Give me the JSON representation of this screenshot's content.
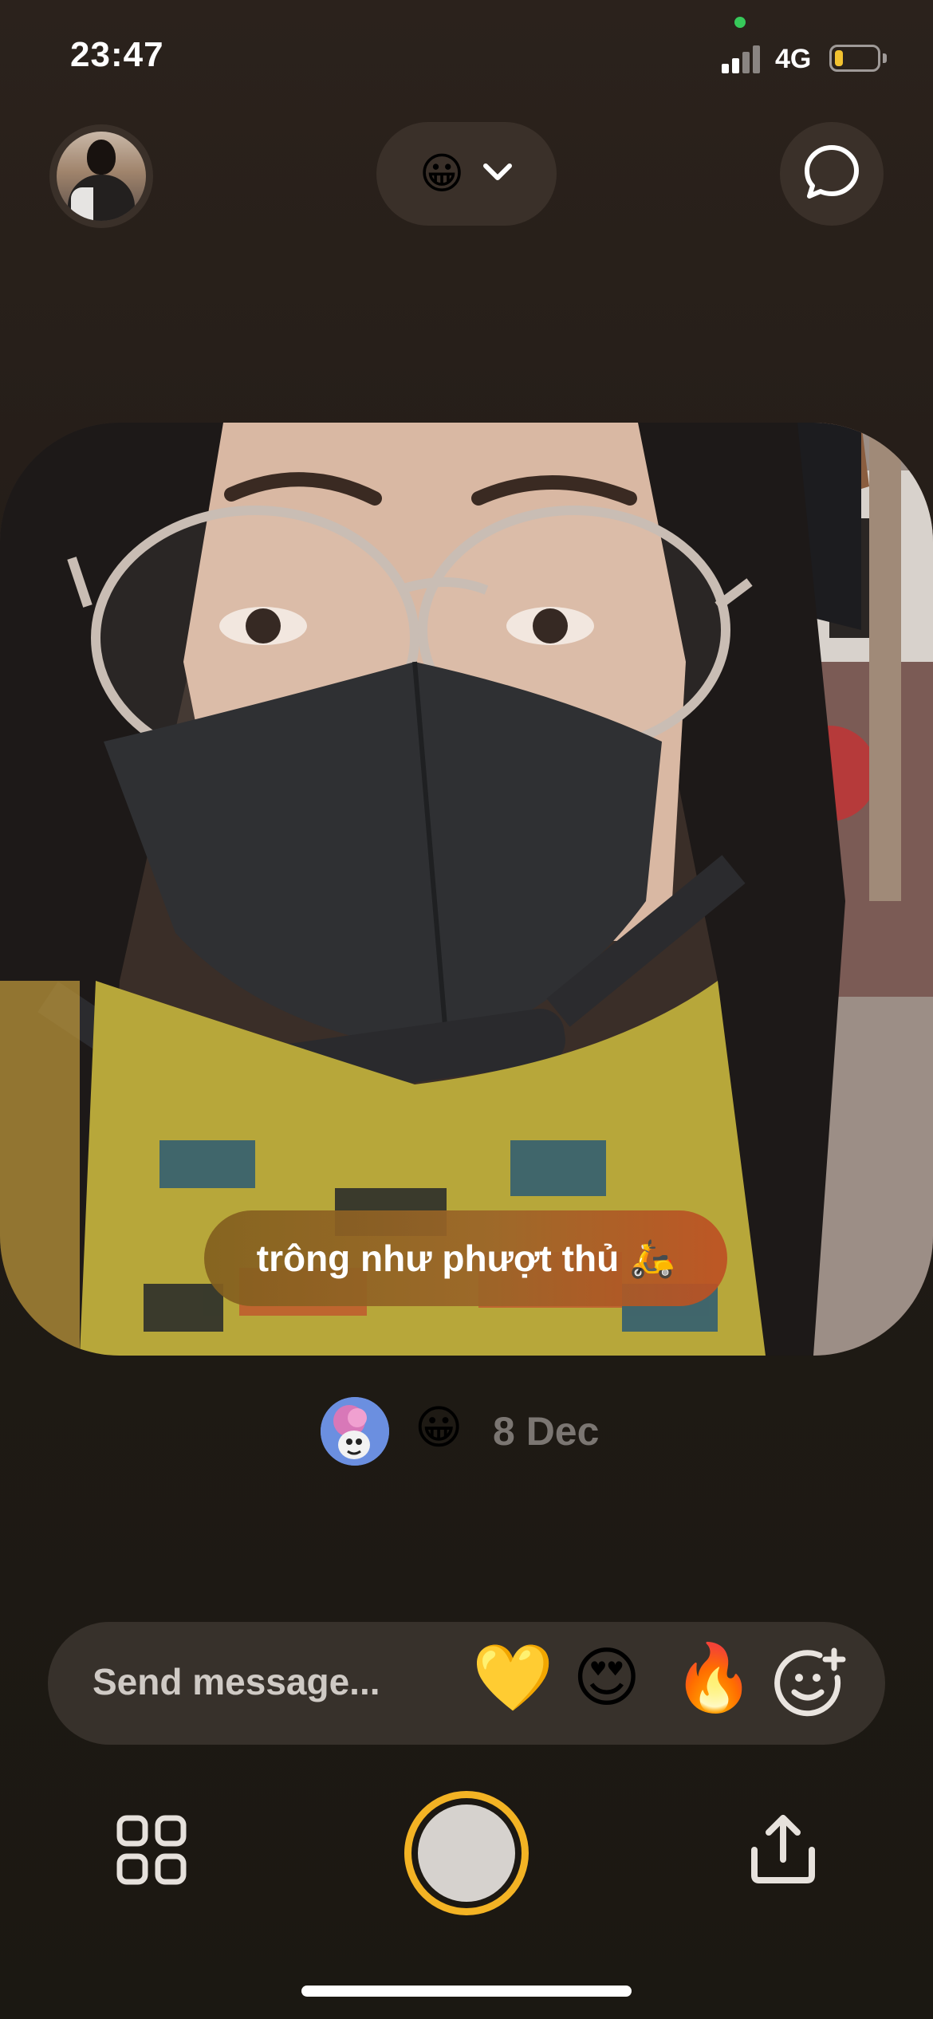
{
  "status_bar": {
    "time": "23:47",
    "network": "4G",
    "battery_level_fraction": 0.2,
    "battery_color": "#f2c230"
  },
  "top_bar": {
    "avatar_icon": "profile-avatar",
    "filter_emoji": "😀",
    "filter_dropdown_icon": "chevron-down-icon",
    "chat_icon": "chat-bubble-icon"
  },
  "post": {
    "caption": "trông như phượt thủ 🛵",
    "sender_avatar_icon": "sender-avatar",
    "reaction_emoji": "😀",
    "date": "8 Dec"
  },
  "message_bar": {
    "placeholder": "Send message...",
    "quick_reactions": [
      "💛",
      "😍",
      "🔥"
    ],
    "add_reaction_icon": "add-reaction-icon"
  },
  "bottom_bar": {
    "grid_icon": "grid-icon",
    "shutter_icon": "shutter-button",
    "share_icon": "share-icon",
    "accent": "#f3b324"
  }
}
